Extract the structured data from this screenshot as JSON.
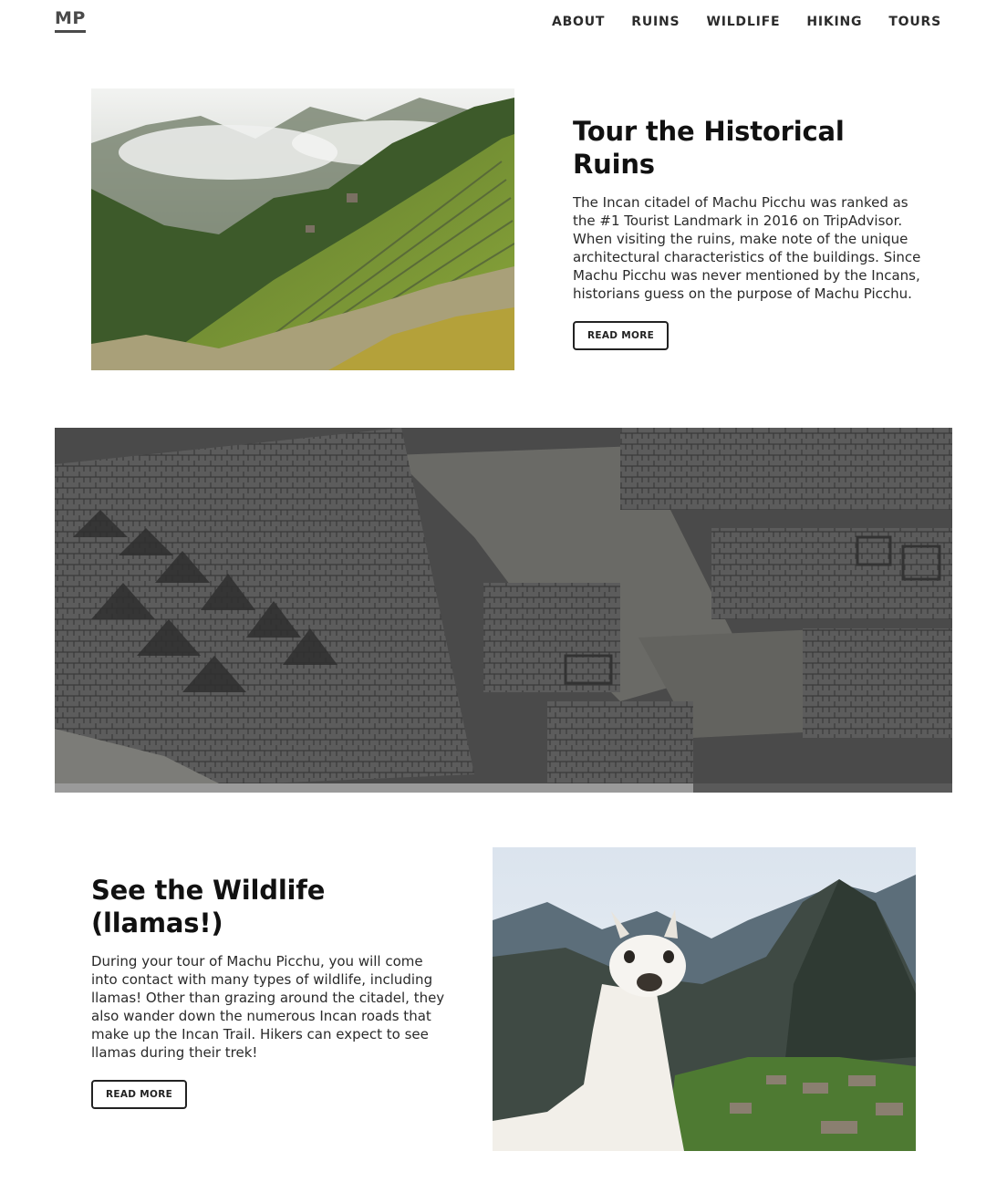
{
  "header": {
    "logo": "MP",
    "nav": [
      {
        "label": "ABOUT"
      },
      {
        "label": "RUINS"
      },
      {
        "label": "WILDLIFE"
      },
      {
        "label": "HIKING"
      },
      {
        "label": "TOURS"
      }
    ]
  },
  "sections": {
    "ruins": {
      "title": "Tour the Historical Ruins",
      "body": "The Incan citadel of Machu Picchu was ranked as the #1 Tourist Landmark in 2016 on TripAdvisor. When visiting the ruins, make note of the unique architectural characteristics of the buildings. Since Machu Picchu was never mentioned by the Incans, historians guess on the purpose of Machu Picchu.",
      "button": "READ MORE"
    },
    "wildlife": {
      "title": "See the Wildlife (llamas!)",
      "body": "During your tour of Machu Picchu, you will come into contact with many types of wildlife, including llamas! Other than grazing around the citadel, they also wander down the numerous Incan roads that make up the Incan Trail. Hikers can expect to see llamas during their trek!",
      "button": "READ MORE"
    }
  }
}
